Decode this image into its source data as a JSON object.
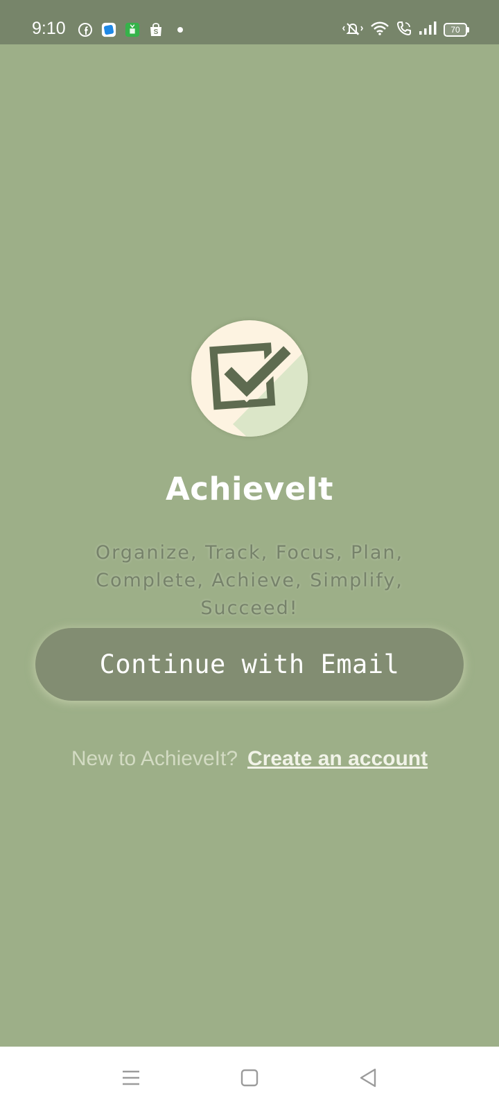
{
  "status_bar": {
    "time": "9:10",
    "battery_level": "70",
    "left_icons": [
      "facebook-icon",
      "app-icon",
      "store-icon",
      "shopping-bag-icon",
      "notification-dot"
    ],
    "right_icons": [
      "mute-icon",
      "wifi-icon",
      "call-icon",
      "signal-icon",
      "battery-icon"
    ]
  },
  "app": {
    "name": "AchieveIt",
    "tagline": "Organize, Track, Focus, Plan, Complete, Achieve, Simplify, Succeed!",
    "logo_icon": "checkbox-check-icon"
  },
  "actions": {
    "continue_email_label": "Continue with Email",
    "signup_prompt": "New to AchieveIt?",
    "signup_link": "Create an account"
  },
  "nav_bar": {
    "buttons": [
      "menu-icon",
      "home-icon",
      "back-icon"
    ]
  },
  "colors": {
    "background": "#9daf88",
    "status_bar": "#77856a",
    "button": "#828d72",
    "logo_background": "#fdf3e1",
    "logo_mark": "#5e6b50"
  }
}
